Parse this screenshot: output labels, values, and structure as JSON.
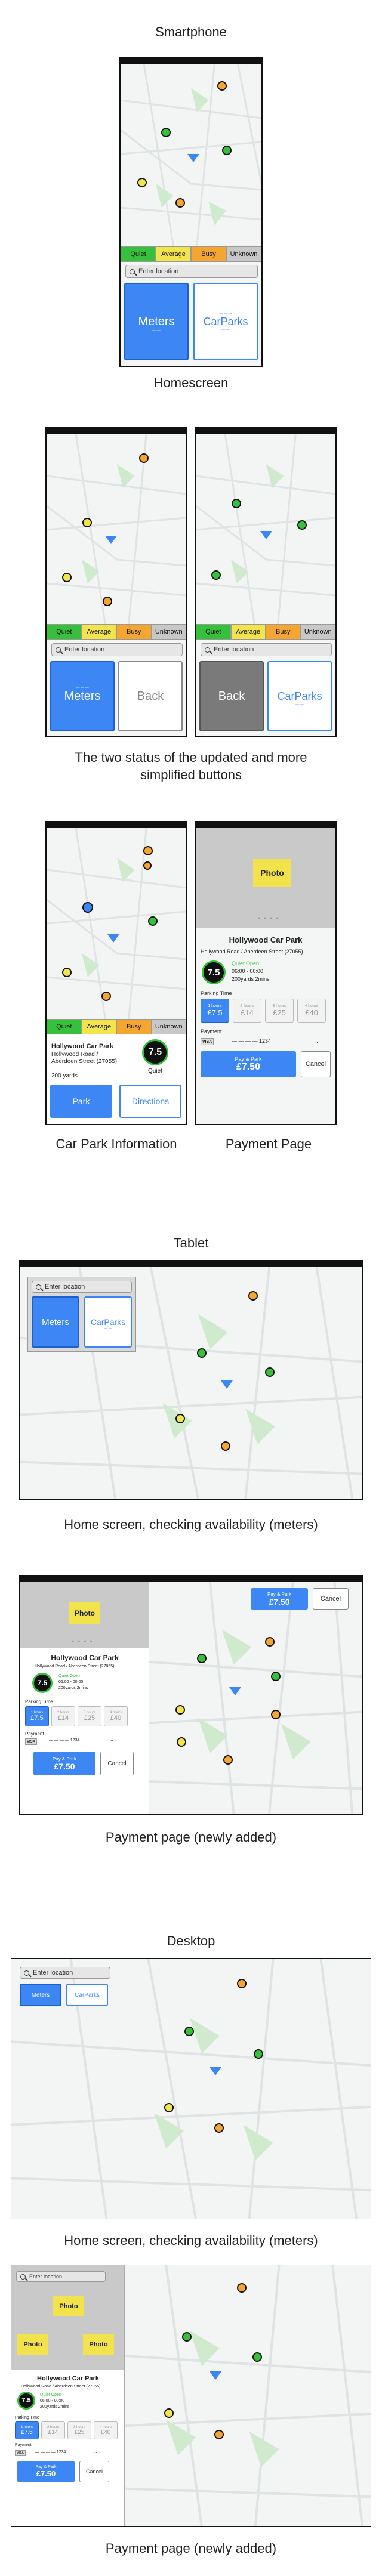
{
  "captions": {
    "smartphone": "Smartphone",
    "homescreen": "Homescreen",
    "simplified": "The two status of the updated and more simplified buttons",
    "carpark_info": "Car Park Information",
    "payment_page": "Payment Page",
    "tablet": "Tablet",
    "tablet_home": "Home screen, checking availability (meters)",
    "tablet_payment": "Payment page (newly added)",
    "desktop": "Desktop",
    "desktop_home": "Home screen, checking availability (meters)",
    "desktop_payment": "Payment page (newly added)"
  },
  "legend": {
    "quiet": "Quiet",
    "average": "Average",
    "busy": "Busy",
    "unknown": "Unknown"
  },
  "search": {
    "placeholder": "Enter location"
  },
  "buttons": {
    "meters": "Meters",
    "carparks": "CarParks",
    "back": "Back",
    "park": "Park",
    "directions": "Directions",
    "cancel": "Cancel",
    "pay_label": "Pay & Park",
    "pay_amount": "£7.50"
  },
  "carpark": {
    "name": "Hollywood Car Park",
    "address_line1": "Hollywood Road /",
    "address_line2": "Aberdeen Street (27055)",
    "address_full": "Hollywood Road / Aberdeen Street (27055)",
    "distance": "200 yards",
    "score": "7.5",
    "status": "Quiet",
    "status_open": "Quiet  Open",
    "hours": "06:00 - 00:00",
    "walk": "200yards  2mins"
  },
  "payment": {
    "photo": "Photo",
    "parking_time": "Parking Time",
    "payment_label": "Payment",
    "card": "VISA",
    "card_masked": "—  —  —  —  1234",
    "slots": [
      {
        "time": "1 hours",
        "price": "£7.5"
      },
      {
        "time": "2 hours",
        "price": "£14"
      },
      {
        "time": "3 hours",
        "price": "£25"
      },
      {
        "time": "4 hours",
        "price": "£40"
      }
    ]
  },
  "colors": {
    "quiet": "#35c23a",
    "average": "#f2e44a",
    "busy": "#f4a630",
    "unknown": "#c8c8c8",
    "accent": "#3d87f5",
    "photo": "#f2e24b"
  }
}
